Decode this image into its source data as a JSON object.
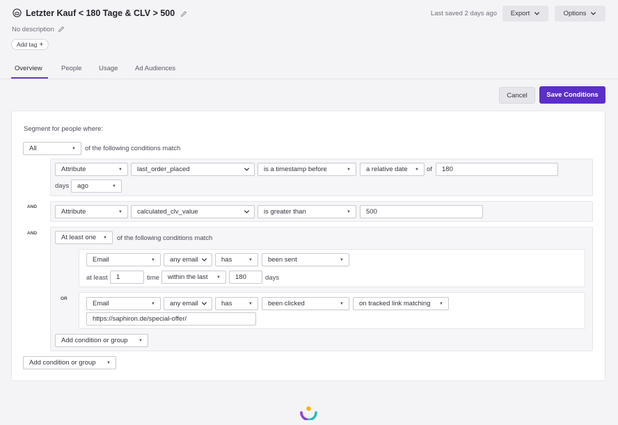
{
  "header": {
    "title": "Letzter Kauf < 180 Tage & CLV > 500",
    "last_saved": "Last saved 2 days ago",
    "export_label": "Export",
    "options_label": "Options",
    "description": "No description",
    "add_tag_label": "Add tag",
    "add_tag_symbol": "+"
  },
  "tabs": [
    {
      "label": "Overview",
      "active": true
    },
    {
      "label": "People"
    },
    {
      "label": "Usage"
    },
    {
      "label": "Ad Audiences"
    }
  ],
  "actions": {
    "cancel_label": "Cancel",
    "save_label": "Save Conditions"
  },
  "segment": {
    "intro": "Segment for people where:",
    "match_mode": "All",
    "match_text": "of the following conditions match",
    "joiners": {
      "and": "AND",
      "or": "OR"
    },
    "condition1": {
      "type": "Attribute",
      "attribute": "last_order_placed",
      "operator": "is a timestamp before",
      "mode": "a relative date",
      "of_text": "of",
      "value": "180",
      "unit_label": "days",
      "direction": "ago"
    },
    "condition2": {
      "type": "Attribute",
      "attribute": "calculated_clv_value",
      "operator": "is greater than",
      "value": "500"
    },
    "subgroup": {
      "match_mode": "At least one",
      "match_text": "of the following conditions match",
      "cond_a": {
        "type": "Email",
        "target": "any email",
        "verb": "has",
        "action": "been sent",
        "atleast_label": "at least",
        "count": "1",
        "time_label": "time",
        "window": "within the last",
        "window_value": "180",
        "window_unit": "days"
      },
      "cond_b": {
        "type": "Email",
        "target": "any email",
        "verb": "has",
        "action": "been clicked",
        "link_filter": "on tracked link matching",
        "url": "https://saphiron.de/special-offer/"
      },
      "add_label": "Add condition or group"
    },
    "add_label": "Add condition or group"
  },
  "icons": {
    "caret": "▼",
    "segment_icon": "segment-icon",
    "pencil": "pencil-icon",
    "logo": "brand-logo-icon"
  },
  "colors": {
    "accent": "#5b2fc9",
    "tab_underline": "#6a35c7"
  }
}
